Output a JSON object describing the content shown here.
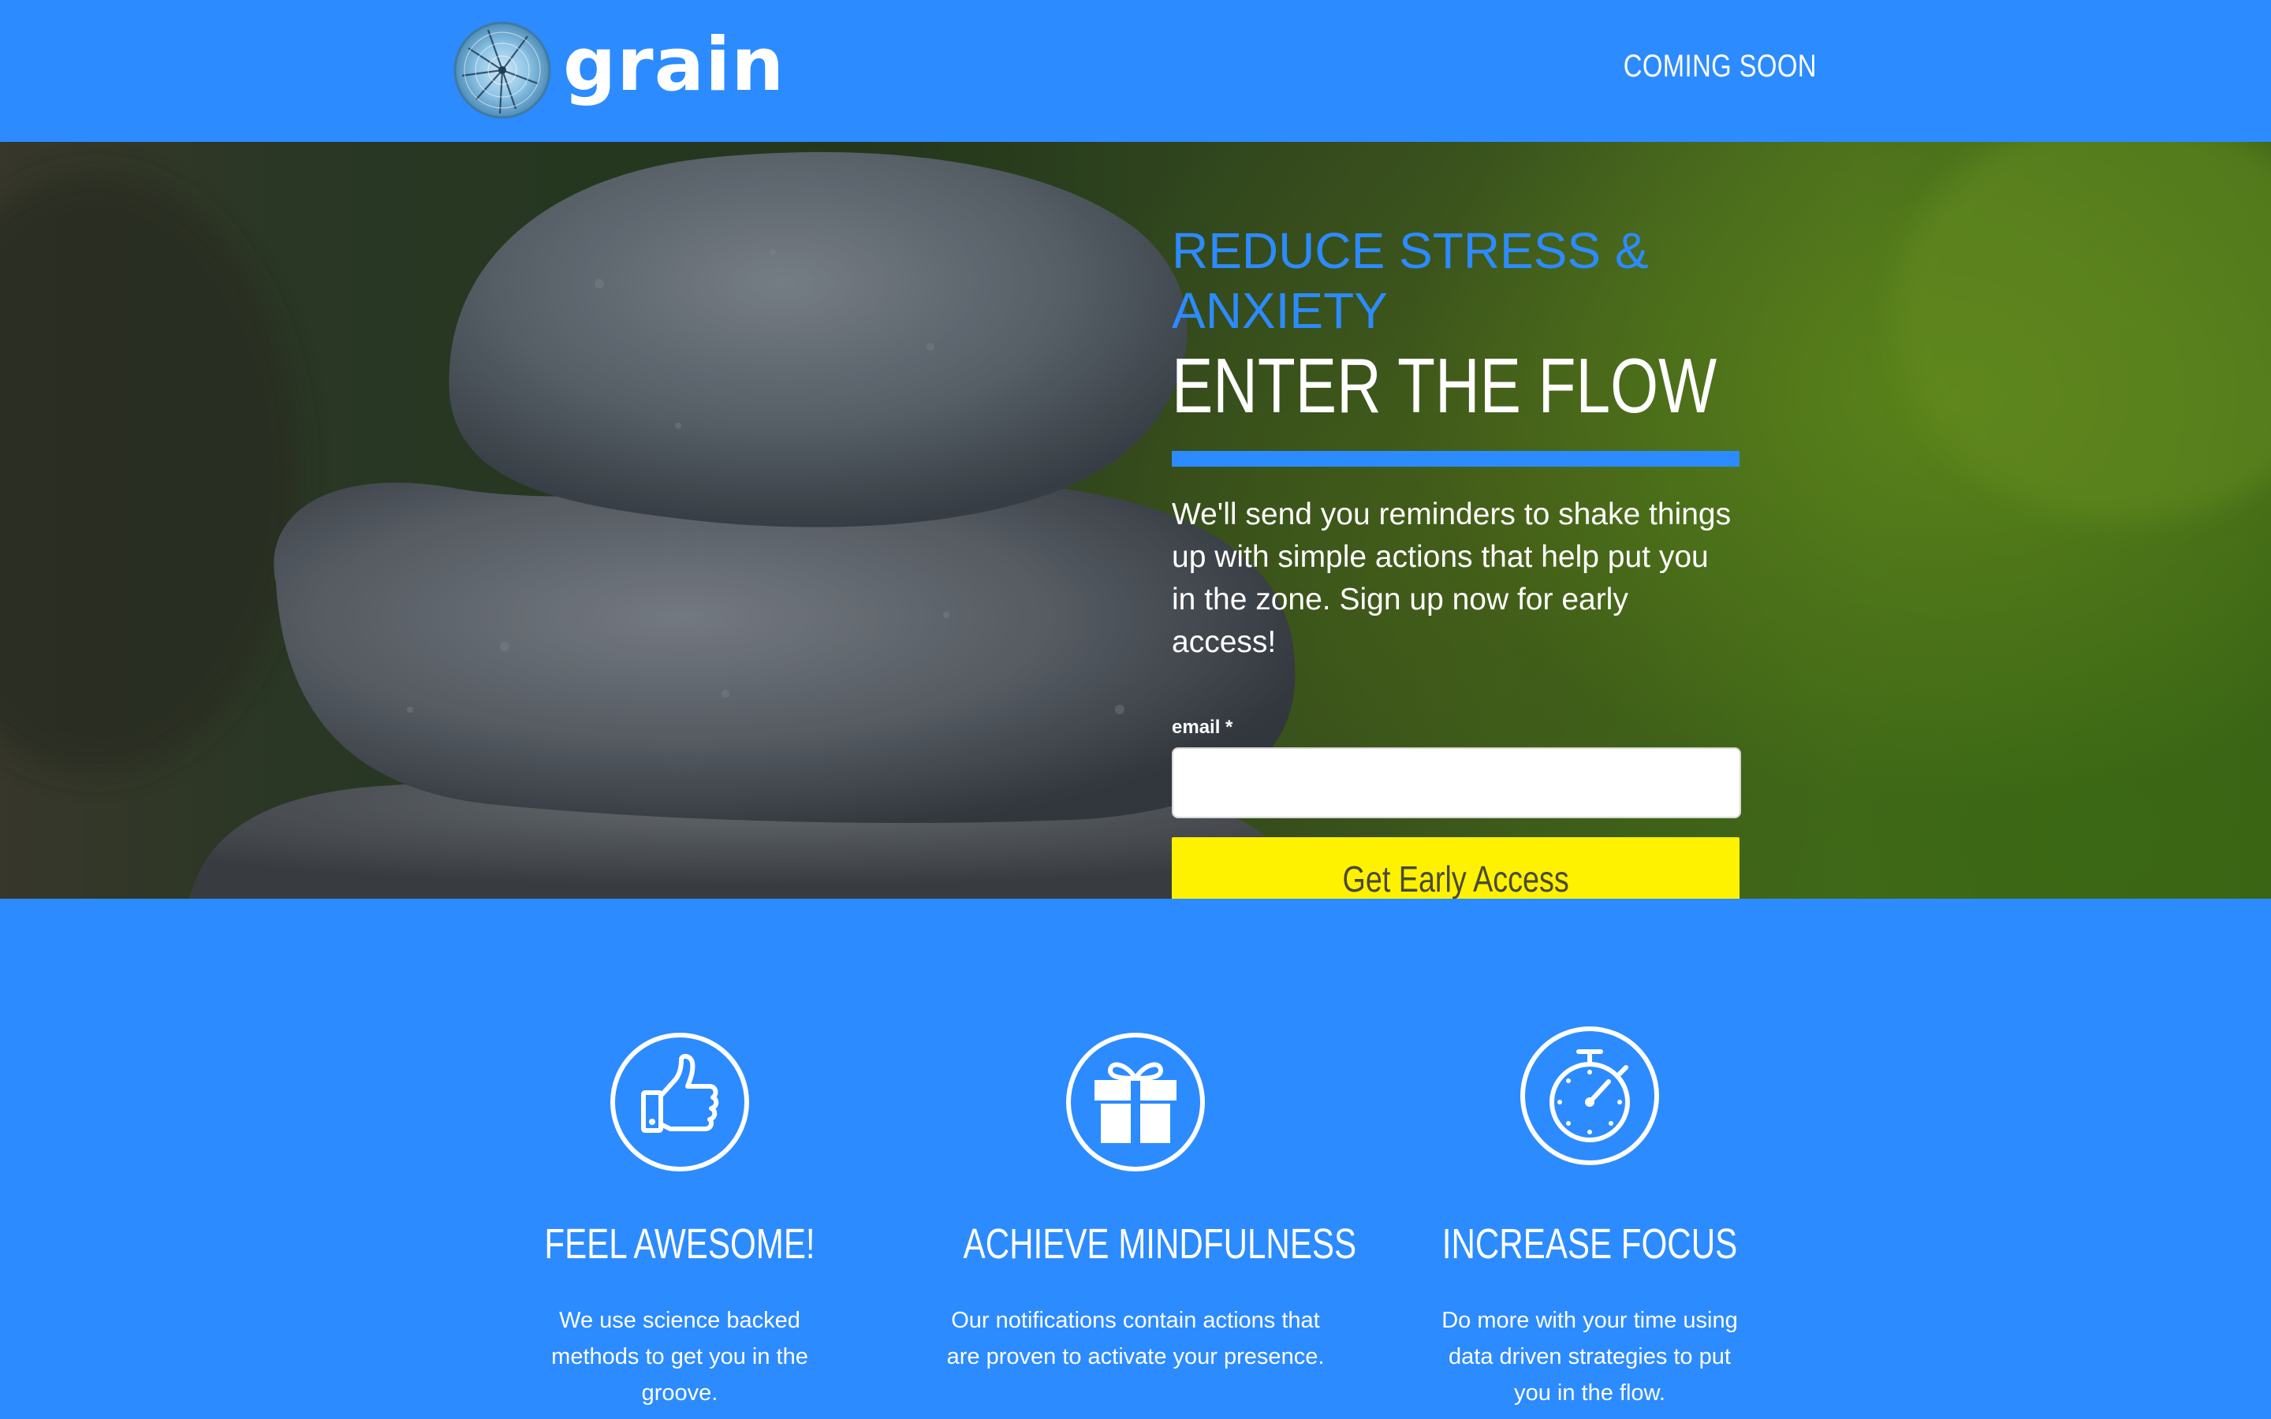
{
  "header": {
    "brand": "grain",
    "nav_link": "COMING SOON"
  },
  "hero": {
    "tagline": "REDUCE STRESS & ANXIETY",
    "headline": "ENTER THE FLOW",
    "lead": "We'll send you reminders to shake things up with simple actions that help put you in the zone. Sign up now for early access!",
    "form": {
      "email_label": "email *",
      "email_value": "",
      "submit_label": "Get Early Access"
    }
  },
  "features": [
    {
      "icon": "thumbs-up-icon",
      "title": "FEEL AWESOME!",
      "text": "We use science backed methods to get you in the groove."
    },
    {
      "icon": "gift-icon",
      "title": "ACHIEVE MINDFULNESS",
      "text": "Our notifications contain actions that are proven to activate your presence."
    },
    {
      "icon": "stopwatch-icon",
      "title": "INCREASE FOCUS",
      "text": "Do more with your time using data driven strategies to put you in the flow."
    }
  ],
  "colors": {
    "brand_blue": "#2c8bff",
    "cta_yellow": "#fff200",
    "white": "#ffffff"
  }
}
